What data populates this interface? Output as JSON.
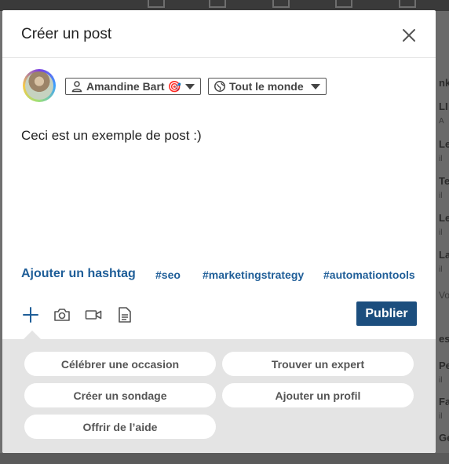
{
  "modal": {
    "title": "Créer un post",
    "author_label": "Amandine Bart 🎯",
    "audience_label": "Tout le monde",
    "post_text": "Ceci est un exemple de post :)",
    "add_hashtag_label": "Ajouter un hashtag",
    "hashtags": [
      "#seo",
      "#marketingstrategy",
      "#automationtools"
    ],
    "publish_label": "Publier",
    "suggestions": [
      "Célébrer une occasion",
      "Trouver un expert",
      "Créer un sondage",
      "Ajouter un profil",
      "Offrir de l’aide"
    ]
  },
  "colors": {
    "accent": "#1f5e98",
    "publish_button": "#1c4e7e",
    "suggest_panel": "#e4e4e4"
  },
  "background": {
    "right_partial_texts": [
      "nk",
      "LI",
      "A",
      "Le",
      "il",
      "Te",
      "il",
      "Le",
      "il",
      "La",
      "il",
      "Vo",
      "es",
      "Pe",
      "il",
      "Fa",
      "il",
      "Ge"
    ]
  }
}
